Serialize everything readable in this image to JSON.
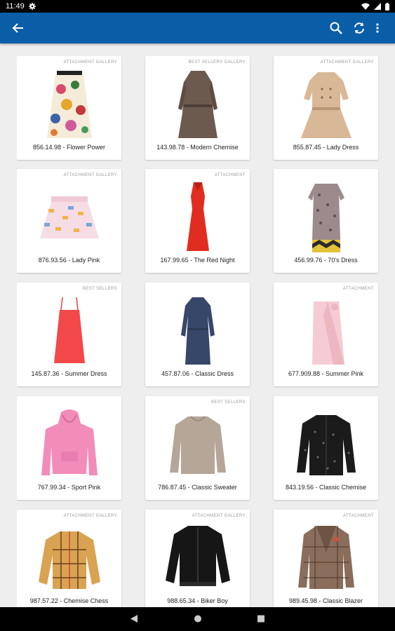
{
  "status": {
    "time": "11:49"
  },
  "appbar": {
    "back_icon": "arrow-back-icon",
    "search_icon": "search-icon",
    "refresh_icon": "sync-icon",
    "menu_icon": "more-vert-icon",
    "color": "#0a5ea8"
  },
  "products": [
    {
      "tag": "ATTACHMENT GALLERY",
      "caption": "856.14.98 - Flower Power",
      "kind": "skirt-floral"
    },
    {
      "tag": "BEST SELLERS GALLERY",
      "caption": "143.98.78 - Modern Chemise",
      "kind": "dress-brown"
    },
    {
      "tag": "ATTACHMENT GALLERY",
      "caption": "855.87.45 - Lady Dress",
      "kind": "dress-trench"
    },
    {
      "tag": "ATTACHMENT GALLERY",
      "caption": "876.93.56 - Lady Pink",
      "kind": "skirt-pink"
    },
    {
      "tag": "ATTACHMENT",
      "caption": "167.99.65 - The Red Night",
      "kind": "gown-red"
    },
    {
      "tag": "",
      "caption": "456.99.76 - 70's Dress",
      "kind": "dress-pattern"
    },
    {
      "tag": "BEST SELLERS",
      "caption": "145.87.36 - Summer Dress",
      "kind": "dress-coral"
    },
    {
      "tag": "",
      "caption": "457.87.06 - Classic Dress",
      "kind": "dress-navy"
    },
    {
      "tag": "ATTACHMENT",
      "caption": "677.909.88 - Summer Pink",
      "kind": "skirt-wrap"
    },
    {
      "tag": "",
      "caption": "767.99.34 - Sport Pink",
      "kind": "hoodie-pink"
    },
    {
      "tag": "BEST SELLERS",
      "caption": "786.87.45 - Classic Sweater",
      "kind": "sweater-beige"
    },
    {
      "tag": "",
      "caption": "843.19.56 - Classic Chemise",
      "kind": "shirt-dots"
    },
    {
      "tag": "ATTACHMENT GALLERY",
      "caption": "987.57.22 - Chemise Chess",
      "kind": "shirt-check"
    },
    {
      "tag": "ATTACHMENT GALLERY",
      "caption": "988.65.34 - Biker Boy",
      "kind": "jacket-bomber"
    },
    {
      "tag": "ATTACHMENT",
      "caption": "989.45.98 - Classic Blazer",
      "kind": "blazer-check"
    }
  ]
}
